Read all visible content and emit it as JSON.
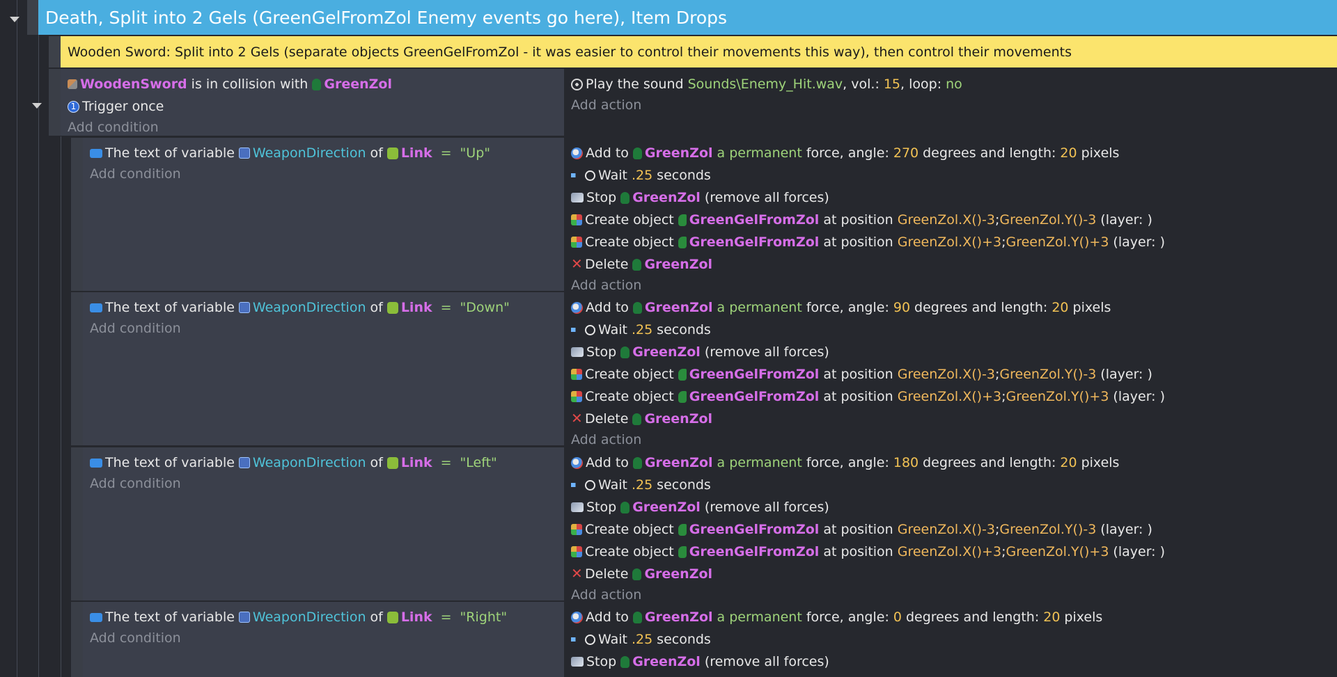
{
  "group": {
    "title": "Death, Split into 2 Gels (GreenGelFromZol Enemy events go here), Item Drops"
  },
  "comment": {
    "text": "Wooden Sword: Split into 2 Gels (separate objects GreenGelFromZol - it was easier to control their movements this way), then control their movements"
  },
  "labels": {
    "add_condition": "Add condition",
    "add_action": "Add action"
  },
  "parent_event": {
    "cond_collision": {
      "object_a": "WoodenSword",
      "text": "is in collision with",
      "object_b": "GreenZol"
    },
    "cond_trigger": {
      "text": "Trigger once",
      "badge": "1"
    },
    "action_sound": {
      "prefix": "Play the sound",
      "file": "Sounds\\Enemy_Hit.wav",
      "vol_label": ", vol.:",
      "vol": "15",
      "loop_label": ", loop:",
      "loop": "no"
    }
  },
  "sub_events": [
    {
      "cond": {
        "prefix": "The text of variable",
        "variable": "WeaponDirection",
        "of": "of",
        "object": "Link",
        "op": "=",
        "value": "\"Up\""
      },
      "force": {
        "add_to": "Add to",
        "object": "GreenZol",
        "mode": "a permanent",
        "mid": "force, angle:",
        "angle": "270",
        "len_label": "degrees and length:",
        "length": "20",
        "unit": "pixels"
      },
      "wait": {
        "label": "Wait",
        "value": ".25",
        "unit": "seconds"
      },
      "stop": {
        "label": "Stop",
        "object": "GreenZol",
        "suffix": "(remove all forces)"
      },
      "create1": {
        "label": "Create object",
        "object": "GreenGelFromZol",
        "at": "at position",
        "x": "GreenZol.X()-3",
        "sep": ";",
        "y": "GreenZol.Y()-3",
        "layer": "(layer: )"
      },
      "create2": {
        "label": "Create object",
        "object": "GreenGelFromZol",
        "at": "at position",
        "x": "GreenZol.X()+3",
        "sep": ";",
        "y": "GreenZol.Y()+3",
        "layer": "(layer: )"
      },
      "delete": {
        "label": "Delete",
        "object": "GreenZol"
      }
    },
    {
      "cond": {
        "prefix": "The text of variable",
        "variable": "WeaponDirection",
        "of": "of",
        "object": "Link",
        "op": "=",
        "value": "\"Down\""
      },
      "force": {
        "add_to": "Add to",
        "object": "GreenZol",
        "mode": "a permanent",
        "mid": "force, angle:",
        "angle": "90",
        "len_label": "degrees and length:",
        "length": "20",
        "unit": "pixels"
      },
      "wait": {
        "label": "Wait",
        "value": ".25",
        "unit": "seconds"
      },
      "stop": {
        "label": "Stop",
        "object": "GreenZol",
        "suffix": "(remove all forces)"
      },
      "create1": {
        "label": "Create object",
        "object": "GreenGelFromZol",
        "at": "at position",
        "x": "GreenZol.X()-3",
        "sep": ";",
        "y": "GreenZol.Y()-3",
        "layer": "(layer: )"
      },
      "create2": {
        "label": "Create object",
        "object": "GreenGelFromZol",
        "at": "at position",
        "x": "GreenZol.X()+3",
        "sep": ";",
        "y": "GreenZol.Y()+3",
        "layer": "(layer: )"
      },
      "delete": {
        "label": "Delete",
        "object": "GreenZol"
      }
    },
    {
      "cond": {
        "prefix": "The text of variable",
        "variable": "WeaponDirection",
        "of": "of",
        "object": "Link",
        "op": "=",
        "value": "\"Left\""
      },
      "force": {
        "add_to": "Add to",
        "object": "GreenZol",
        "mode": "a permanent",
        "mid": "force, angle:",
        "angle": "180",
        "len_label": "degrees and length:",
        "length": "20",
        "unit": "pixels"
      },
      "wait": {
        "label": "Wait",
        "value": ".25",
        "unit": "seconds"
      },
      "stop": {
        "label": "Stop",
        "object": "GreenZol",
        "suffix": "(remove all forces)"
      },
      "create1": {
        "label": "Create object",
        "object": "GreenGelFromZol",
        "at": "at position",
        "x": "GreenZol.X()-3",
        "sep": ";",
        "y": "GreenZol.Y()-3",
        "layer": "(layer: )"
      },
      "create2": {
        "label": "Create object",
        "object": "GreenGelFromZol",
        "at": "at position",
        "x": "GreenZol.X()+3",
        "sep": ";",
        "y": "GreenZol.Y()+3",
        "layer": "(layer: )"
      },
      "delete": {
        "label": "Delete",
        "object": "GreenZol"
      }
    },
    {
      "cond": {
        "prefix": "The text of variable",
        "variable": "WeaponDirection",
        "of": "of",
        "object": "Link",
        "op": "=",
        "value": "\"Right\""
      },
      "force": {
        "add_to": "Add to",
        "object": "GreenZol",
        "mode": "a permanent",
        "mid": "force, angle:",
        "angle": "0",
        "len_label": "degrees and length:",
        "length": "20",
        "unit": "pixels"
      },
      "wait": {
        "label": "Wait",
        "value": ".25",
        "unit": "seconds"
      },
      "stop": {
        "label": "Stop",
        "object": "GreenZol",
        "suffix": "(remove all forces)"
      }
    }
  ]
}
